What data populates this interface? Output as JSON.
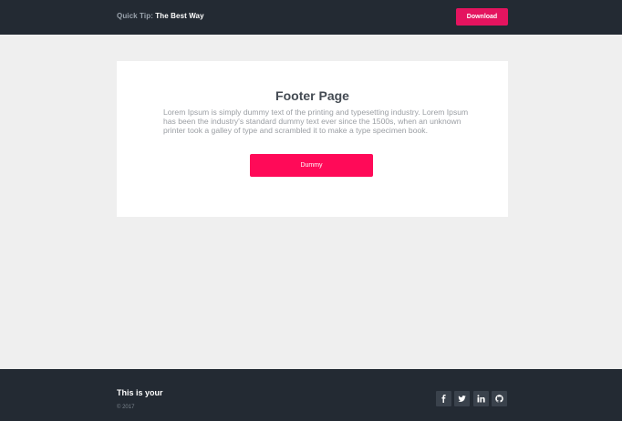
{
  "header": {
    "tip_label": "Quick Tip:",
    "tip_value": "The Best Way",
    "download_label": "Download",
    "download_color": "#e4145f",
    "background": "#232a33"
  },
  "card": {
    "title": "Footer Page",
    "body": "Lorem Ipsum is simply dummy text of the printing and typesetting industry. Lorem Ipsum has been the industry's standard dummy text ever since the 1500s, when an unknown printer took a galley of type and scrambled it to make a type specimen book.",
    "button_label": "Dummy",
    "button_color": "#ff0a58"
  },
  "footer": {
    "title": "This is your",
    "copyright": "© 2017",
    "social": [
      {
        "icon": "facebook-icon"
      },
      {
        "icon": "twitter-icon"
      },
      {
        "icon": "linkedin-icon"
      },
      {
        "icon": "github-icon"
      }
    ]
  }
}
